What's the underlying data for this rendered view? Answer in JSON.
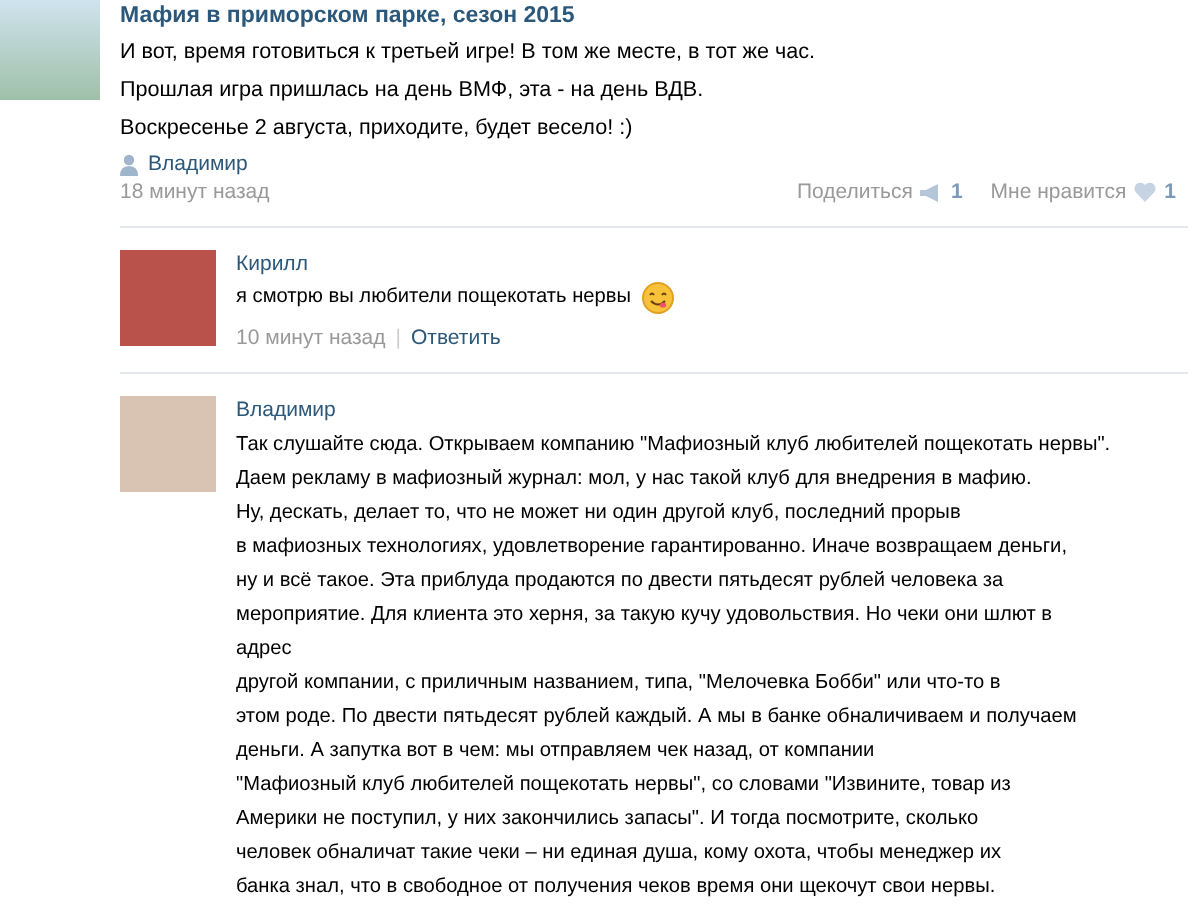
{
  "post": {
    "title": "Мафия в приморском парке, сезон 2015",
    "lines": [
      "И вот, время готовиться к третьей игре! В том же месте, в тот же час.",
      "Прошлая игра пришлась на день ВМФ, эта - на день ВДВ.",
      "Воскресенье 2 августа, приходите, будет весело! :)"
    ],
    "author": "Владимир",
    "time": "18 минут назад",
    "share_label": "Поделиться",
    "share_count": "1",
    "like_label": "Мне нравится",
    "like_count": "1"
  },
  "comments": [
    {
      "author": "Кирилл",
      "lines": [
        "я смотрю вы любители пощекотать нервы"
      ],
      "emoji": true,
      "time": "10 минут назад",
      "separator": "|",
      "reply": "Ответить"
    },
    {
      "author": "Владимир",
      "lines": [
        "Так слушайте сюда. Открываем компанию \"Мафиозный клуб любителей пощекотать нервы\".",
        "Даем рекламу в мафиозный журнал: мол, у нас такой клуб для внедрения в мафию.",
        "Ну, дескать, делает то, что не может ни один другой клуб, последний прорыв",
        "в мафиозных технологиях, удовлетворение гарантированно. Иначе возвращаем деньги,",
        "ну и всё такое. Эта приблуда продаются по двести пятьдесят рублей человека за",
        "мероприятие. Для клиента это херня, за такую кучу удовольствия. Но чеки они шлют в",
        "адрес",
        "другой компании, с приличным названием, типа, \"Мелочевка Бобби\" или что-то в",
        "этом роде. По двести пятьдесят рублей каждый. А мы в банке обналичиваем и получаем",
        "деньги. А запутка вот в чем: мы отправляем чек назад, от компании",
        "\"Мафиозный клуб любителей пощекотать нервы\", со словами \"Извините, товар из",
        "Америки не поступил, у них закончились запасы\". И тогда посмотрите, сколько",
        "человек обналичат такие чеки – ни единая душа, кому охота, чтобы менеджер их",
        "банка знал, что в свободное от получения чеков время они щекочут свои нервы."
      ],
      "emoji": false
    }
  ]
}
